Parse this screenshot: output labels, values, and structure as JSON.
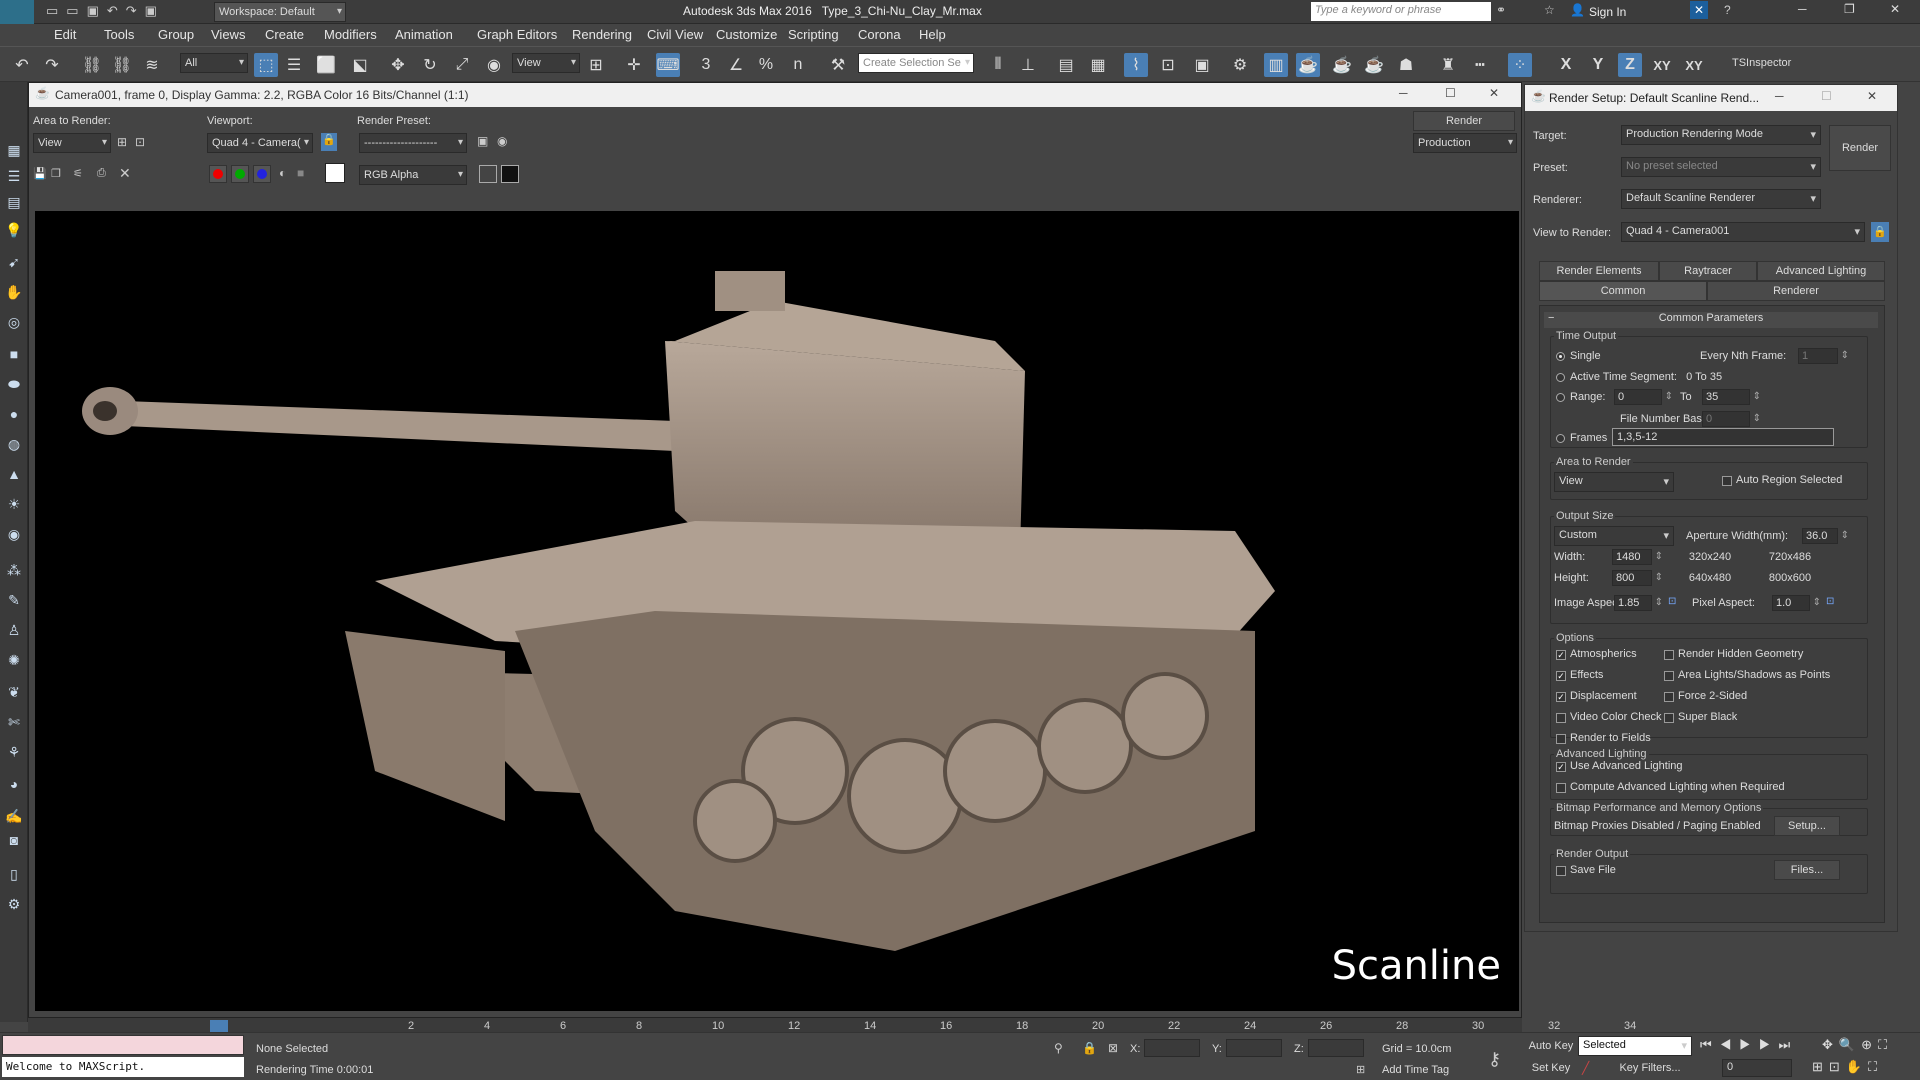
{
  "app": {
    "title": "Autodesk 3ds Max 2016",
    "filename": "Type_3_Chi-Nu_Clay_Mr.max",
    "workspace": "Workspace: Default",
    "search_placeholder": "Type a keyword or phrase",
    "signin": "Sign In",
    "logo": "MAX"
  },
  "menus": [
    "Edit",
    "Tools",
    "Group",
    "Views",
    "Create",
    "Modifiers",
    "Animation",
    "Graph Editors",
    "Rendering",
    "Civil View",
    "Customize",
    "Scripting",
    "Corona",
    "Help"
  ],
  "toolbar": {
    "filter": "All",
    "refcoord": "View",
    "selection_set": "Create Selection Se",
    "axes": [
      "X",
      "Y",
      "Z",
      "XY",
      "XY"
    ],
    "tsinspector": "TSInspector",
    "snap_3": "3",
    "snap_percent": "%",
    "snap_n": "n"
  },
  "vfb": {
    "title": "Camera001, frame 0, Display Gamma: 2.2, RGBA Color 16 Bits/Channel (1:1)",
    "area_label": "Area to Render:",
    "area_value": "View",
    "viewport_label": "Viewport:",
    "viewport_value": "Quad 4 - Camera(",
    "preset_label": "Render Preset:",
    "preset_value": "--------------------",
    "render_button": "Render",
    "mode_value": "Production",
    "channel_value": "RGB Alpha",
    "watermark": "Scanline"
  },
  "render_setup": {
    "title": "Render Setup: Default Scanline Rend...",
    "target_label": "Target:",
    "target_value": "Production Rendering Mode",
    "preset_label": "Preset:",
    "preset_value": "No preset selected",
    "renderer_label": "Renderer:",
    "renderer_value": "Default Scanline Renderer",
    "view_label": "View to Render:",
    "view_value": "Quad 4 - Camera001",
    "render_button": "Render",
    "tabs_row1": [
      "Render Elements",
      "Raytracer",
      "Advanced Lighting"
    ],
    "tabs_row2": [
      "Common",
      "Renderer"
    ],
    "rollout": "Common Parameters",
    "time_output": {
      "label": "Time Output",
      "single": "Single",
      "nth_label": "Every Nth Frame:",
      "nth_value": "1",
      "active_segment": "Active Time Segment:",
      "active_range": "0 To 35",
      "range": "Range:",
      "range_from": "0",
      "to": "To",
      "range_to": "35",
      "file_base_label": "File Number Base:",
      "file_base_value": "0",
      "frames": "Frames",
      "frames_value": "1,3,5-12"
    },
    "area": {
      "label": "Area to Render",
      "value": "View",
      "auto_region": "Auto Region Selected"
    },
    "output": {
      "label": "Output Size",
      "preset": "Custom",
      "aperture_label": "Aperture Width(mm):",
      "aperture_value": "36.0",
      "width_label": "Width:",
      "width_value": "1480",
      "height_label": "Height:",
      "height_value": "800",
      "p1": "320x240",
      "p2": "720x486",
      "p3": "640x480",
      "p4": "800x600",
      "aspect_label": "Image Aspect:",
      "aspect_value": "1.85",
      "pixel_label": "Pixel Aspect:",
      "pixel_value": "1.0"
    },
    "options": {
      "label": "Options",
      "items": [
        {
          "label": "Atmospherics",
          "checked": true
        },
        {
          "label": "Render Hidden Geometry",
          "checked": false
        },
        {
          "label": "Effects",
          "checked": true
        },
        {
          "label": "Area Lights/Shadows as Points",
          "checked": false
        },
        {
          "label": "Displacement",
          "checked": true
        },
        {
          "label": "Force 2-Sided",
          "checked": false
        },
        {
          "label": "Video Color Check",
          "checked": false
        },
        {
          "label": "Super Black",
          "checked": false
        },
        {
          "label": "Render to Fields",
          "checked": false
        }
      ]
    },
    "adv": {
      "label": "Advanced Lighting",
      "use": "Use Advanced Lighting",
      "compute": "Compute Advanced Lighting when Required"
    },
    "bitmap": {
      "label": "Bitmap Performance and Memory Options",
      "status": "Bitmap Proxies Disabled / Paging Enabled",
      "setup": "Setup..."
    },
    "render_output": {
      "label": "Render Output",
      "save": "Save File",
      "files": "Files..."
    }
  },
  "timeline": {
    "ticks": [
      "2",
      "4",
      "6",
      "8",
      "10",
      "12",
      "14",
      "16",
      "18",
      "20",
      "22",
      "24",
      "26",
      "28",
      "30",
      "32",
      "34"
    ]
  },
  "status": {
    "maxscript": "Welcome to MAXScript.",
    "selected": "None Selected",
    "render_time": "Rendering Time  0:00:01",
    "x_label": "X:",
    "y_label": "Y:",
    "z_label": "Z:",
    "grid": "Grid = 10.0cm",
    "add_tag": "Add Time Tag",
    "auto_key": "Auto Key",
    "set_key": "Set Key",
    "selected_drop": "Selected",
    "key_filters": "Key Filters...",
    "frame": "0"
  }
}
